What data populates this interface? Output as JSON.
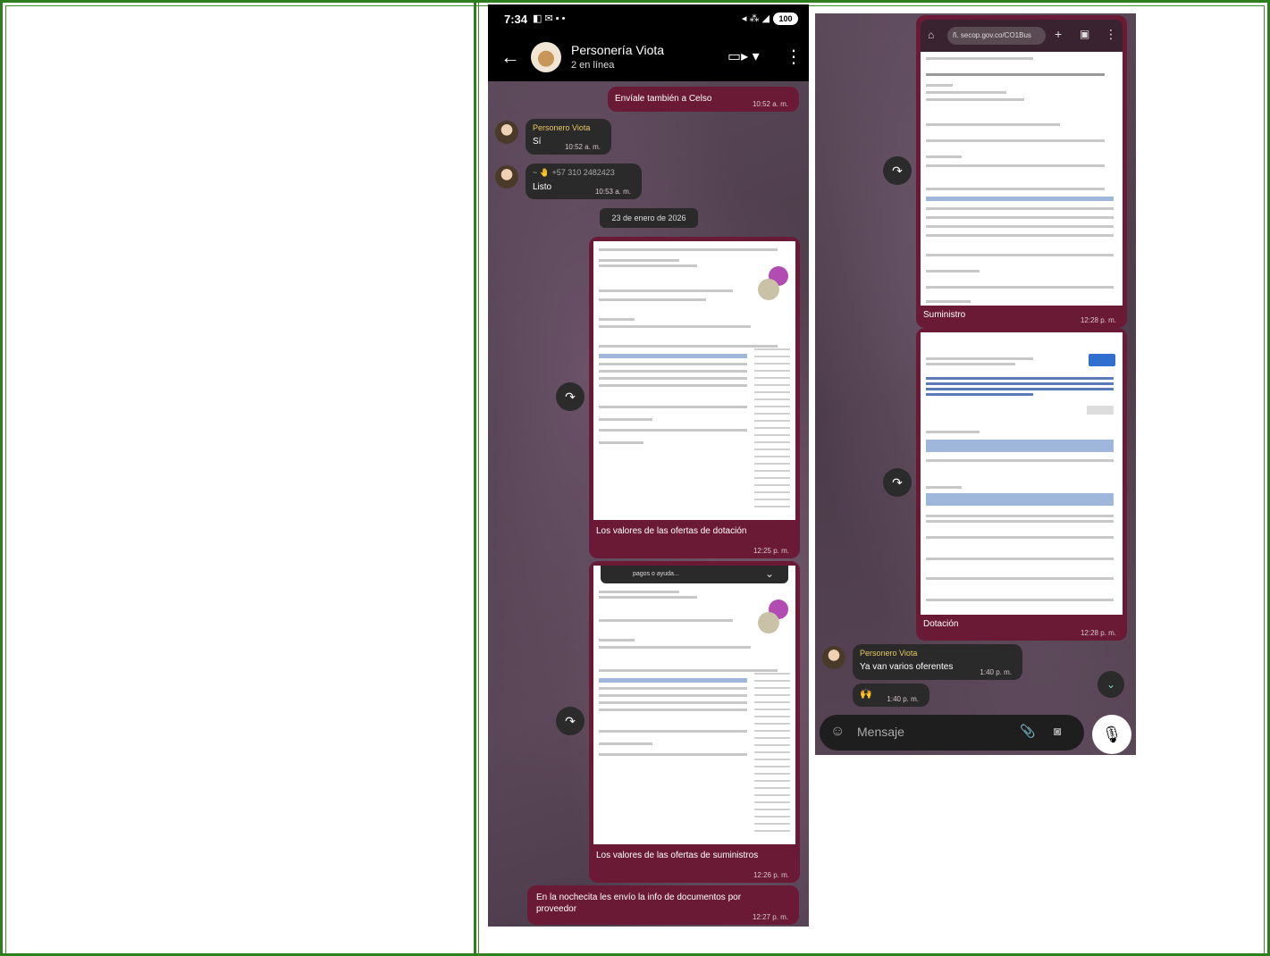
{
  "chat": {
    "status_time": "7:34",
    "status_icons_left": "◧ ✉ ▪ •",
    "status_icons_right": "◂ ⁂ ◢",
    "battery": "100",
    "contact_name": "Personería Viota",
    "contact_status": "2 en línea",
    "messages": [
      {
        "text": "Envíale también a Celso",
        "time": "10:52 a. m."
      },
      {
        "sender": "Personero Viota",
        "text": "Sí",
        "time": "10:52 a. m."
      },
      {
        "sender": "~ 🤚 +57 310 2482423",
        "text": "Listo",
        "time": "10:53 a. m."
      }
    ],
    "date_separator": "23 de enero de 2026",
    "images": [
      {
        "caption": "Los valores de las ofertas de dotación",
        "time": "12:25 p. m."
      },
      {
        "caption": "Los valores de las ofertas de suministros",
        "time": "12:26 p. m."
      }
    ],
    "overlay_text": "pagos o ayuda...",
    "last_message": {
      "text": "En la nochecita les envío la info de documentos por proveedor",
      "time": "12:27 p. m."
    }
  },
  "chat2": {
    "browser_url": "ñ. secop.gov.co/CO1Bus",
    "images": [
      {
        "caption": "Suministro",
        "time": "12:28 p. m."
      },
      {
        "caption": "Dotación",
        "time": "12:28 p. m."
      }
    ],
    "reply_sender": "Personero Viota",
    "reply_text": "Ya van varios oferentes",
    "reply_time": "1:40 p. m.",
    "reaction": "🙌",
    "reaction_time": "1:40 p. m.",
    "input_placeholder": "Mensaje"
  },
  "icons": {
    "back": "←",
    "video": "▭▸ ▾",
    "menu": "⋮",
    "forward": "↷",
    "emoji": "☺",
    "attach": "📎",
    "camera": "◙",
    "mic": "🎙",
    "chevron_down": "⌄",
    "home": "⌂",
    "plus": "+",
    "tabs": "▣",
    "browser_menu": "⋮"
  },
  "colors": {
    "frame": "#2e7d1f",
    "outgoing_bubble": "#6b1a36",
    "incoming_bubble": "#2a2a2a",
    "sender_name": "#e8c860"
  }
}
